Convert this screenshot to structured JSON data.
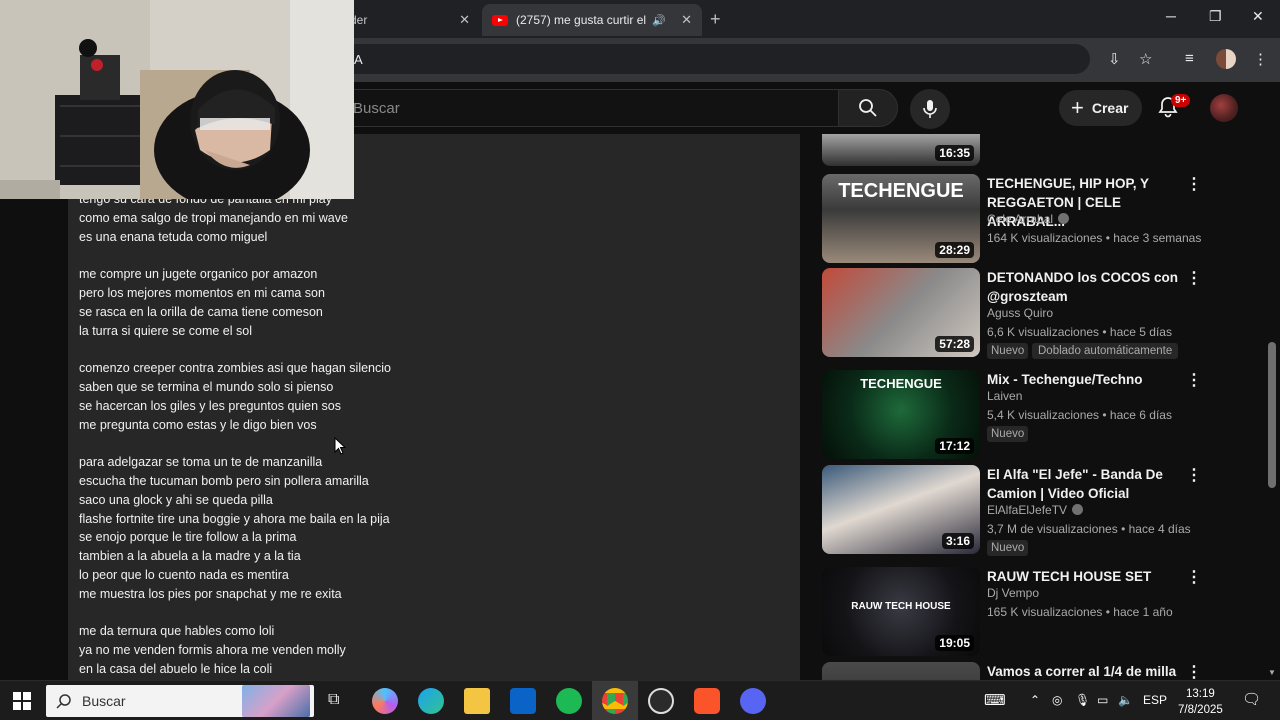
{
  "browser": {
    "tabs": [
      {
        "title": "der"
      },
      {
        "title": "(2757) me gusta curtir el m"
      }
    ],
    "address_text": "A",
    "window_controls": [
      "minimize-icon",
      "restore-icon",
      "close-icon"
    ]
  },
  "youtube": {
    "search_placeholder": "Buscar",
    "create_label": "Crear",
    "notifications_badge": "9+"
  },
  "description": {
    "lyrics": [
      "tengo su cara de fondo de pantalla en mi play",
      "como ema salgo de tropi manejando en mi wave",
      "es una enana tetuda como miguel",
      "",
      "me compre un jugete organico por amazon",
      "pero los mejores momentos en mi cama son",
      "se rasca en la orilla de cama tiene comeson",
      "la turra si quiere se come el sol",
      "",
      "comenzo creeper contra zombies asi que hagan silencio",
      "saben que se termina el mundo solo si pienso",
      "se hacercan los giles y les preguntos quien sos",
      "me pregunta como estas y le digo bien vos",
      "",
      "para adelgazar se toma un te de manzanilla",
      "escucha the tucuman bomb pero sin pollera amarilla",
      "saco una glock y ahi se queda pilla",
      "flashe fortnite tire una boggie y ahora me baila en la pija",
      "se enojo porque le tire follow a la prima",
      "tambien a la abuela a la madre y a la tia",
      "lo peor que lo cuento nada es mentira",
      "me muestra los pies por snapchat y me re exita",
      "",
      "me da ternura que hables como loli",
      "ya no me venden formis ahora me venden molly",
      "en la casa del abuelo le hice la coli"
    ]
  },
  "related": [
    {
      "title": "",
      "channel": "",
      "meta": "",
      "duration": "16:35",
      "badges": []
    },
    {
      "title": "TECHENGUE, HIP HOP,  Y REGGAETON | CELE ARRABAL...",
      "channel": "Cele Arrabal",
      "verified": true,
      "meta": "164 K visualizaciones • hace 3 semanas",
      "duration": "28:29",
      "thumb_text": "TECHENGUE",
      "badges": []
    },
    {
      "title": "DETONANDO los COCOS con @groszteam",
      "channel": "Aguss Quiro",
      "meta": "6,6 K visualizaciones • hace 5 días",
      "duration": "57:28",
      "badges": [
        "Nuevo",
        "Doblado automáticamente"
      ]
    },
    {
      "title": "Mix - Techengue/Techno",
      "channel": "Laiven",
      "meta": "5,4 K visualizaciones • hace 6 días",
      "duration": "17:12",
      "thumb_text": "TECHENGUE",
      "badges": [
        "Nuevo"
      ]
    },
    {
      "title": "El Alfa \"El Jefe\" - Banda De Camion | Video Oficial",
      "channel": "ElAlfaElJefeTV",
      "verified": true,
      "meta": "3,7 M de visualizaciones • hace 4 días",
      "duration": "3:16",
      "badges": [
        "Nuevo"
      ]
    },
    {
      "title": "RAUW TECH HOUSE SET",
      "channel": "Dj Vempo",
      "meta": "165 K visualizaciones • hace 1 año",
      "duration": "19:05",
      "thumb_text": "RAUW TECH HOUSE",
      "badges": []
    },
    {
      "title": "Vamos a correr al 1/4 de milla",
      "channel": "",
      "meta": "",
      "duration": "",
      "badges": []
    }
  ],
  "taskbar": {
    "search_label": "Buscar",
    "language": "ESP",
    "time": "13:19",
    "date": "7/8/2025"
  },
  "colors": {
    "background": "#0f0f0f",
    "panel": "#272727",
    "youtube_red": "#ff0000",
    "badge_red": "#cc0000"
  }
}
